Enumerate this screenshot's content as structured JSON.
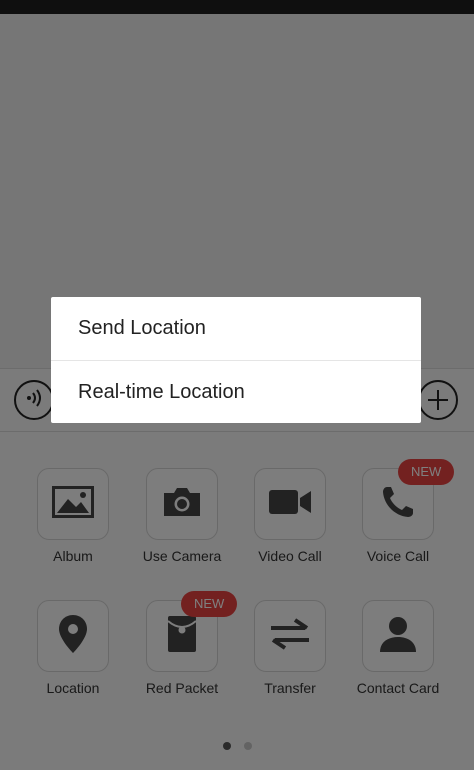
{
  "panel": {
    "row1": [
      {
        "label": "Album",
        "icon": "image-icon"
      },
      {
        "label": "Use Camera",
        "icon": "camera-icon"
      },
      {
        "label": "Video Call",
        "icon": "video-camera-icon"
      },
      {
        "label": "Voice Call",
        "icon": "phone-icon",
        "badge": "NEW"
      }
    ],
    "row2": [
      {
        "label": "Location",
        "icon": "location-pin-icon"
      },
      {
        "label": "Red Packet",
        "icon": "red-packet-icon",
        "badge": "NEW"
      },
      {
        "label": "Transfer",
        "icon": "transfer-arrows-icon"
      },
      {
        "label": "Contact Card",
        "icon": "person-icon"
      }
    ],
    "page_count": 2,
    "active_page": 1
  },
  "dialog": {
    "items": [
      {
        "label": "Send Location"
      },
      {
        "label": "Real-time Location"
      }
    ]
  },
  "colors": {
    "badge": "#e64340",
    "icon": "#444444",
    "overlay": "rgba(0,0,0,0.5)"
  }
}
